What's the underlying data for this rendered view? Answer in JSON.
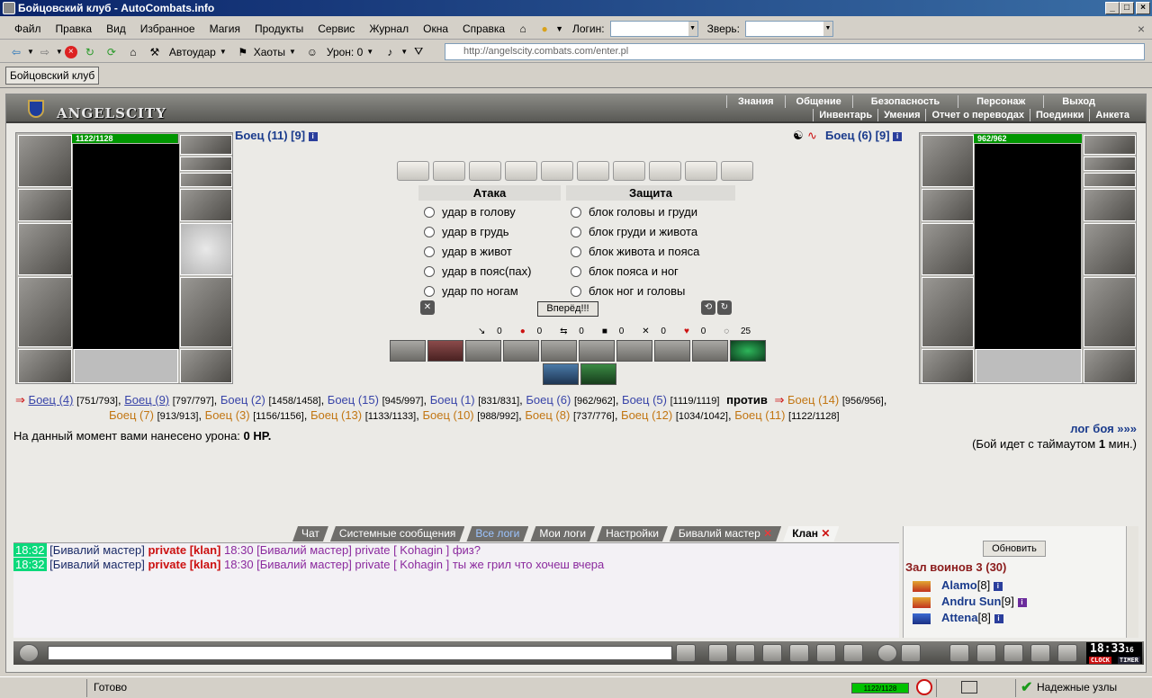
{
  "window": {
    "title": "Бойцовский клуб - AutoCombats.info"
  },
  "menu": {
    "items": [
      "Файл",
      "Правка",
      "Вид",
      "Избранное",
      "Магия",
      "Продукты",
      "Сервис",
      "Журнал",
      "Окна",
      "Справка"
    ],
    "login_label": "Логин:",
    "pet_label": "Зверь:"
  },
  "toolbar": {
    "autostrike": "Автоудар",
    "chaos": "Хаоты",
    "damage": "Урон: 0",
    "url": "http://angelscity.combats.com/enter.pl"
  },
  "browser_tab": "Бойцовский клуб",
  "game": {
    "logo": "ANGELSCITY",
    "nav_top": [
      "Знания",
      "Общение",
      "Безопасность",
      "Персонаж",
      "Выход"
    ],
    "nav_bottom": [
      "Инвентарь",
      "Умения",
      "Отчет о переводах",
      "Поединки",
      "Анкета"
    ]
  },
  "left_fighter": {
    "name": "Боец (11)",
    "level": "[9]",
    "hp": "1122/1128",
    "hp_fraction": 0.995
  },
  "right_fighter": {
    "name": "Боец (6)",
    "level": "[9]",
    "hp": "962/962",
    "hp_fraction": 1.0
  },
  "combat": {
    "attack_header": "Атака",
    "defense_header": "Защита",
    "attacks": [
      "удар в голову",
      "удар в грудь",
      "удар в живот",
      "удар в пояс(пах)",
      "удар по ногам"
    ],
    "blocks": [
      "блок головы и груди",
      "блок груди и живота",
      "блок живота и пояса",
      "блок пояса и ног",
      "блок ног и головы"
    ],
    "forward_button": "Вперёд!!!",
    "stats": [
      "0",
      "0",
      "0",
      "0",
      "0",
      "0",
      "25"
    ]
  },
  "teams": {
    "team1": [
      {
        "name": "Боец (4)",
        "hp": "[751/793]"
      },
      {
        "name": "Боец (9)",
        "hp": "[797/797]"
      },
      {
        "name": "Боец (2)",
        "hp": "[1458/1458]"
      },
      {
        "name": "Боец (15)",
        "hp": "[945/997]"
      },
      {
        "name": "Боец (1)",
        "hp": "[831/831]"
      },
      {
        "name": "Боец (6)",
        "hp": "[962/962]"
      },
      {
        "name": "Боец (5)",
        "hp": "[1119/1119]"
      }
    ],
    "versus": "против",
    "team2": [
      {
        "name": "Боец (14)",
        "hp": "[956/956]"
      },
      {
        "name": "Боец (7)",
        "hp": "[913/913]"
      },
      {
        "name": "Боец (3)",
        "hp": "[1156/1156]"
      },
      {
        "name": "Боец (13)",
        "hp": "[1133/1133]"
      },
      {
        "name": "Боец (10)",
        "hp": "[988/992]"
      },
      {
        "name": "Боец (8)",
        "hp": "[737/776]"
      },
      {
        "name": "Боец (12)",
        "hp": "[1034/1042]"
      },
      {
        "name": "Боец (11)",
        "hp": "[1122/1128]"
      }
    ]
  },
  "damage_text": "На данный момент вами нанесено урона:",
  "damage_value": "0 HP.",
  "log_link": "лог боя »»»",
  "timeout_text": "(Бой идет с таймаутом",
  "timeout_value": "1",
  "timeout_unit": "мин.)",
  "chat": {
    "tabs": [
      "Чат",
      "Системные сообщения",
      "Все логи",
      "Мои логи",
      "Настройки",
      "Бивалий мастер",
      "Клан"
    ],
    "messages": [
      {
        "time": "18:32",
        "user": "[Бивалий мастер]",
        "tag": "private [klan]",
        "text": "18:30 [Бивалий мастер] private [ Kohagin ] физ?"
      },
      {
        "time": "18:32",
        "user": "[Бивалий мастер]",
        "tag": "private [klan]",
        "text": "18:30 [Бивалий мастер] private [ Kohagin ] ты же грил что хочеш вчера"
      }
    ]
  },
  "room": {
    "refresh": "Обновить",
    "name": "Зал воинов 3 (30)",
    "players": [
      {
        "name": "Alamo",
        "level": "[8]"
      },
      {
        "name": "Andru Sun",
        "level": "[9]"
      },
      {
        "name": "Attena",
        "level": "[8]"
      }
    ]
  },
  "clock": {
    "time": "18:33",
    "sec": "16",
    "clock_label": "CLOCK",
    "timer_label": "TIMER"
  },
  "status": {
    "ready": "Готово",
    "hp": "1122/1128",
    "zone": "Надежные узлы"
  }
}
